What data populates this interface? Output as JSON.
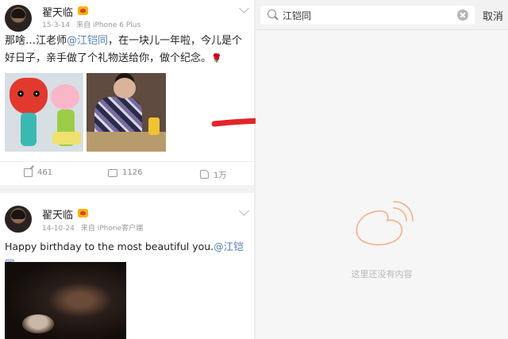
{
  "posts": [
    {
      "author": "翟天临",
      "date": "15-3-14",
      "source": "来自 iPhone 6 Plus",
      "text_pre": "那啥…江老师",
      "mention": "@江铠同",
      "text_post": "，在一块儿一年啦，今儿是个好日子，亲手做了个礼物送给你，做个纪念。",
      "emoji": "🌹",
      "stats": {
        "reposts": "461",
        "comments": "1126",
        "likes": "1万"
      }
    },
    {
      "author": "翟天临",
      "date": "14-10-24",
      "source": "来自 iPhone客户端",
      "text_pre": "Happy birthday to the most beautiful you.",
      "mention": "@江铠同"
    }
  ],
  "search": {
    "query": "江铠同",
    "cancel_label": "取消",
    "empty_message": "这里还没有内容"
  },
  "colors": {
    "arrow": "#e0262b",
    "mention": "#5680b5",
    "empty_icon": "#f0a070"
  },
  "icons": [
    "search-icon",
    "clear-icon",
    "repost-icon",
    "comment-icon",
    "like-icon",
    "vip-badge-icon",
    "chevron-down-icon",
    "empty-weibo-icon",
    "arrow-right-icon"
  ]
}
